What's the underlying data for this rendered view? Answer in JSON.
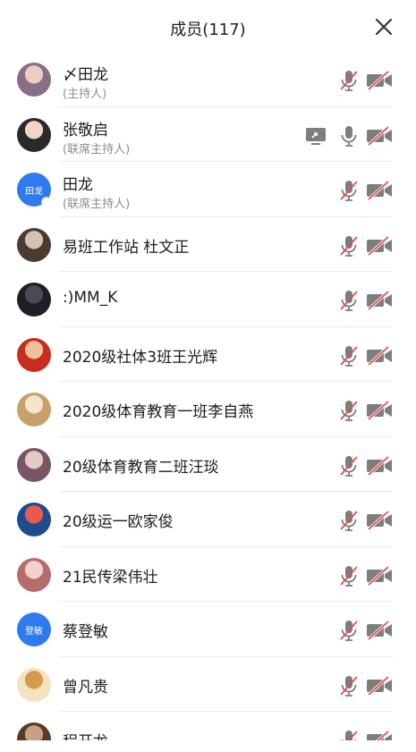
{
  "header": {
    "title": "成员(117)"
  },
  "members": [
    {
      "name": "〆田龙",
      "role": "(主持人)",
      "avatar": {
        "type": "photo",
        "c1": "#8a6d86",
        "c2": "#e8cfc1"
      },
      "mic_muted": true,
      "cam_off": true,
      "sharing": false
    },
    {
      "name": "张敬启",
      "role": "(联席主持人)",
      "avatar": {
        "type": "photo",
        "c1": "#2a2a2a",
        "c2": "#f1d6c7"
      },
      "mic_muted": false,
      "cam_off": true,
      "sharing": true
    },
    {
      "name": "田龙",
      "role": "(联席主持人)",
      "avatar": {
        "type": "text",
        "label": "田龙"
      },
      "mic_muted": true,
      "cam_off": true,
      "sharing": false
    },
    {
      "name": " 易班工作站 杜文正",
      "role": "",
      "avatar": {
        "type": "photo",
        "c1": "#4b3c33",
        "c2": "#d6c2b2"
      },
      "mic_muted": true,
      "cam_off": true,
      "sharing": false
    },
    {
      "name": ":)MM_K",
      "role": "",
      "avatar": {
        "type": "photo",
        "c1": "#1e1e26",
        "c2": "#4a4a55"
      },
      "mic_muted": true,
      "cam_off": true,
      "sharing": false
    },
    {
      "name": "2020级社体3班王光辉",
      "role": "",
      "avatar": {
        "type": "photo",
        "c1": "#c62d20",
        "c2": "#f0c09a"
      },
      "mic_muted": true,
      "cam_off": true,
      "sharing": false
    },
    {
      "name": "2020级体育教育一班李自燕",
      "role": "",
      "avatar": {
        "type": "photo",
        "c1": "#c9a06a",
        "c2": "#f3e3cf"
      },
      "mic_muted": true,
      "cam_off": true,
      "sharing": false
    },
    {
      "name": "20级体育教育二班汪琰",
      "role": "",
      "avatar": {
        "type": "photo",
        "c1": "#7a5566",
        "c2": "#e6c9c4"
      },
      "mic_muted": true,
      "cam_off": true,
      "sharing": false
    },
    {
      "name": "20级运一欧家俊",
      "role": "",
      "avatar": {
        "type": "photo",
        "c1": "#1f4b8f",
        "c2": "#e85a4f"
      },
      "mic_muted": true,
      "cam_off": true,
      "sharing": false
    },
    {
      "name": "21民传梁伟壮",
      "role": "",
      "avatar": {
        "type": "photo",
        "c1": "#b86b6b",
        "c2": "#f2d2cd"
      },
      "mic_muted": true,
      "cam_off": true,
      "sharing": false
    },
    {
      "name": "蔡登敏",
      "role": "",
      "avatar": {
        "type": "text",
        "label": "登敏"
      },
      "mic_muted": true,
      "cam_off": true,
      "sharing": false
    },
    {
      "name": "曾凡贵",
      "role": "",
      "avatar": {
        "type": "photo",
        "c1": "#f3e3c0",
        "c2": "#d79a4a"
      },
      "mic_muted": true,
      "cam_off": true,
      "sharing": false
    },
    {
      "name": "程开龙",
      "role": "",
      "avatar": {
        "type": "photo",
        "c1": "#5a3a2a",
        "c2": "#c7a184"
      },
      "mic_muted": true,
      "cam_off": true,
      "sharing": false
    }
  ],
  "colors": {
    "muted_slash": "#e0514a",
    "icon": "#7d7d7d",
    "avatar_text_bg": "#2e7bf0"
  },
  "icons": {
    "close": "close-icon",
    "mic": "microphone-icon",
    "camera": "camera-off-icon",
    "share": "screen-share-icon"
  }
}
